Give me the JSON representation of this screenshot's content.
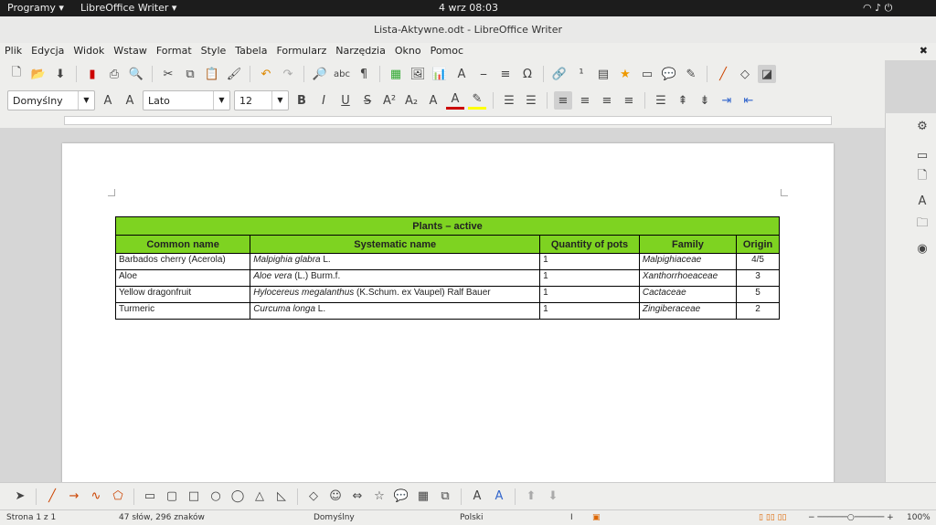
{
  "system_bar": {
    "apps_menu": "Programy ▾",
    "app_name": "LibreOffice Writer ▾",
    "clock": "4 wrz  08:03"
  },
  "window": {
    "title": "Lista-Aktywne.odt - LibreOffice Writer"
  },
  "menu": [
    "Plik",
    "Edycja",
    "Widok",
    "Wstaw",
    "Format",
    "Style",
    "Tabela",
    "Formularz",
    "Narzędzia",
    "Okno",
    "Pomoc"
  ],
  "formatting": {
    "paragraph_style": "Domyślny",
    "font_name": "Lato",
    "font_size": "12"
  },
  "table": {
    "title": "Plants – active",
    "headers": [
      "Common name",
      "Systematic name",
      "Quantity of pots",
      "Family",
      "Origin"
    ],
    "rows": [
      {
        "common": "Barbados cherry (Acerola)",
        "sys_italic": "Malpighia glabra",
        "sys_rest": " L.",
        "qty": "1",
        "family": "Malpighiaceae",
        "origin": "4/5"
      },
      {
        "common": "Aloe",
        "sys_italic": "Aloe vera",
        "sys_rest": " (L.) Burm.f.",
        "qty": "1",
        "family": "Xanthorrhoeaceae",
        "origin": "3"
      },
      {
        "common": "Yellow dragonfruit",
        "sys_italic": "Hylocereus megalanthus",
        "sys_rest": " (K.Schum. ex Vaupel) Ralf Bauer",
        "qty": "1",
        "family": "Cactaceae",
        "origin": "5"
      },
      {
        "common": "Turmeric",
        "sys_italic": "Curcuma longa",
        "sys_rest": " L.",
        "qty": "1",
        "family": "Zingiberaceae",
        "origin": "2"
      }
    ]
  },
  "status": {
    "page": "Strona 1 z 1",
    "words": "47 słów, 296 znaków",
    "style": "Domyślny",
    "language": "Polski",
    "zoom": "100%"
  },
  "colors": {
    "table_header": "#7ed321"
  }
}
